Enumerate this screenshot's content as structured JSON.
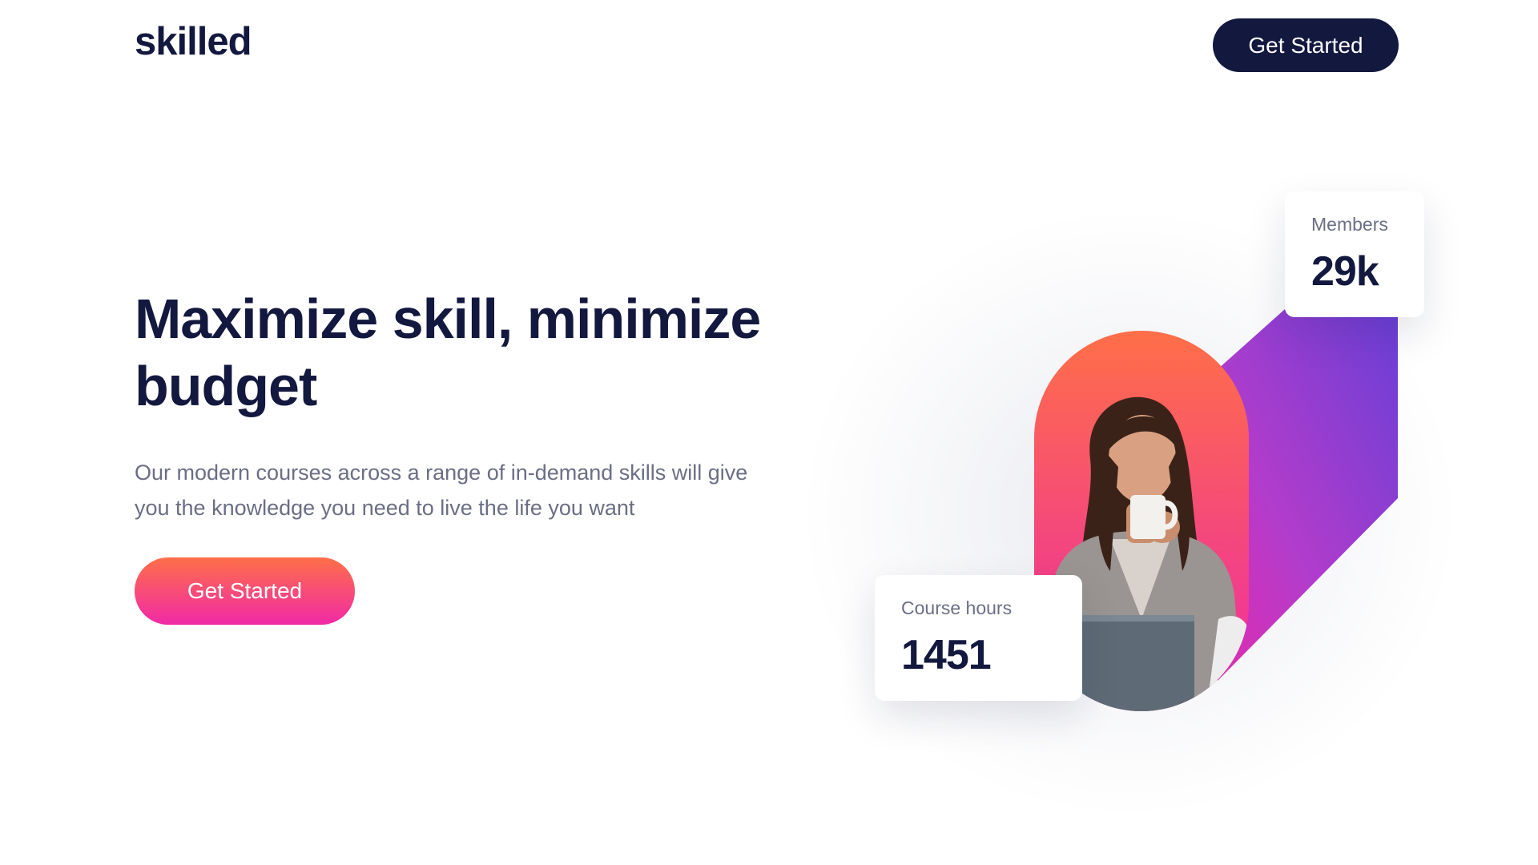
{
  "header": {
    "logo": "skilled",
    "cta_label": "Get Started"
  },
  "hero": {
    "headline": "Maximize skill, minimize budget",
    "subhead": "Our modern courses across a range of in-demand skills will give you the knowledge you need to live the life you want",
    "cta_label": "Get Started"
  },
  "stats": {
    "members": {
      "label": "Members",
      "value": "29k"
    },
    "course_hours": {
      "label": "Course hours",
      "value": "1451"
    }
  },
  "colors": {
    "navy": "#13183F",
    "gray_text": "#6B6E85",
    "gradient_orange": "#FF6F48",
    "gradient_pink": "#F02AA6",
    "gradient_purple": "#6A3FD6"
  },
  "illustration": {
    "photo_subject": "woman-drinking-coffee-with-laptop"
  }
}
